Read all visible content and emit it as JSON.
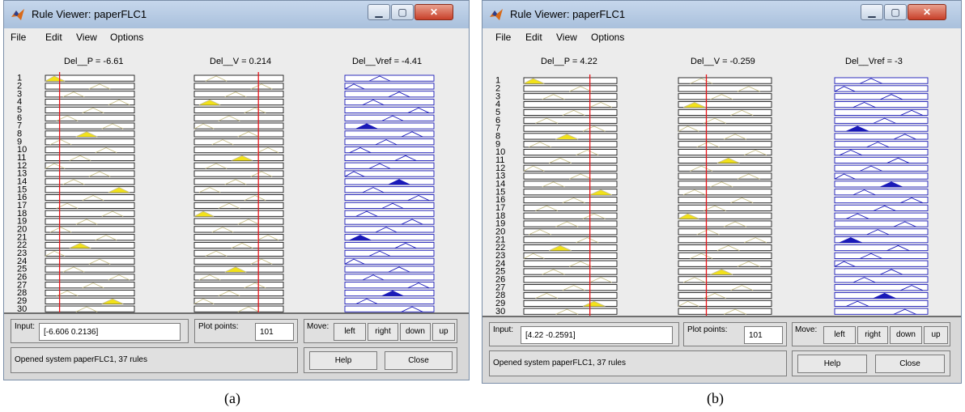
{
  "colors": {
    "input_line": "#e8141a",
    "consequent": "#1a1ab8",
    "fill_yellow": "#f2e21a",
    "bar_border": "#1a1a1a",
    "antecedent_line": "#c9c08a"
  },
  "icons": [
    "matlab-logo-icon",
    "minimize-icon",
    "maximize-icon",
    "close-icon"
  ],
  "row_labels": [
    "1",
    "2",
    "3",
    "4",
    "5",
    "6",
    "7",
    "8",
    "9",
    "10",
    "11",
    "12",
    "13",
    "14",
    "15",
    "16",
    "17",
    "18",
    "19",
    "20",
    "21",
    "22",
    "23",
    "24",
    "25",
    "26",
    "27",
    "28",
    "29",
    "30"
  ],
  "windows": [
    {
      "title": "Rule Viewer: paperFLC1",
      "menu": [
        "File",
        "Edit",
        "View",
        "Options"
      ],
      "variables": [
        "Del__P = -6.61",
        "Del__V = 0.214",
        "Del__Vref = -4.41"
      ],
      "input_label": "Input:",
      "input_value": "[-6.606 0.2136]",
      "plot_points_label": "Plot points:",
      "plot_points_value": "101",
      "move_label": "Move:",
      "move_buttons": [
        "left",
        "right",
        "down",
        "up"
      ],
      "status": "Opened system paperFLC1, 37 rules",
      "help_label": "Help",
      "close_label": "Close",
      "caption": "(a)",
      "input_fraction": [
        0.16,
        0.72
      ]
    },
    {
      "title": "Rule Viewer: paperFLC1",
      "menu": [
        "File",
        "Edit",
        "View",
        "Options"
      ],
      "variables": [
        "Del__P = 4.22",
        "Del__V = -0.259",
        "Del__Vref = -3"
      ],
      "input_label": "Input:",
      "input_value": "[4.22 -0.2591]",
      "plot_points_label": "Plot points:",
      "plot_points_value": "101",
      "move_label": "Move:",
      "move_buttons": [
        "left",
        "right",
        "down",
        "up"
      ],
      "status": "Opened system paperFLC1, 37 rules",
      "help_label": "Help",
      "close_label": "Close",
      "caption": "(b)",
      "input_fraction": [
        0.71,
        0.3
      ]
    }
  ]
}
